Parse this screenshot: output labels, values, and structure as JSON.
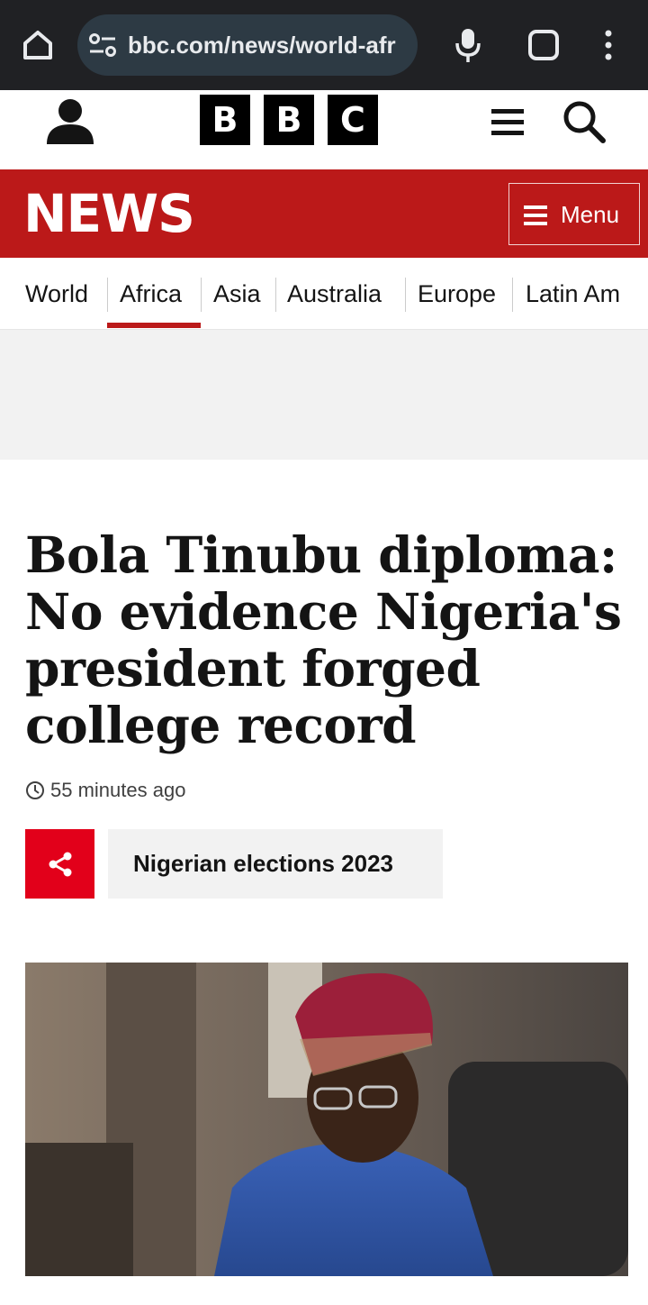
{
  "browser": {
    "url": "bbc.com/news/world-afr",
    "icons": [
      "home-icon",
      "site-settings-icon",
      "microphone-icon",
      "tabs-icon",
      "more-options-icon"
    ]
  },
  "header": {
    "logo_letters": [
      "B",
      "B",
      "C"
    ],
    "icons": [
      "account-icon",
      "menu-icon",
      "search-icon"
    ]
  },
  "news_bar": {
    "wordmark": "NEWS",
    "menu_label": "Menu",
    "brand_color": "#bb1919"
  },
  "section_nav": {
    "items": [
      {
        "label": "World"
      },
      {
        "label": "Africa",
        "active": true
      },
      {
        "label": "Asia"
      },
      {
        "label": "Australia"
      },
      {
        "label": "Europe"
      },
      {
        "label": "Latin Am"
      }
    ]
  },
  "article": {
    "headline": "Bola Tinubu diploma: No evidence Nigeria's president forged college record",
    "timestamp": "55 minutes ago",
    "topic_tag": "Nigerian elections 2023",
    "share_color": "#e2001a"
  }
}
